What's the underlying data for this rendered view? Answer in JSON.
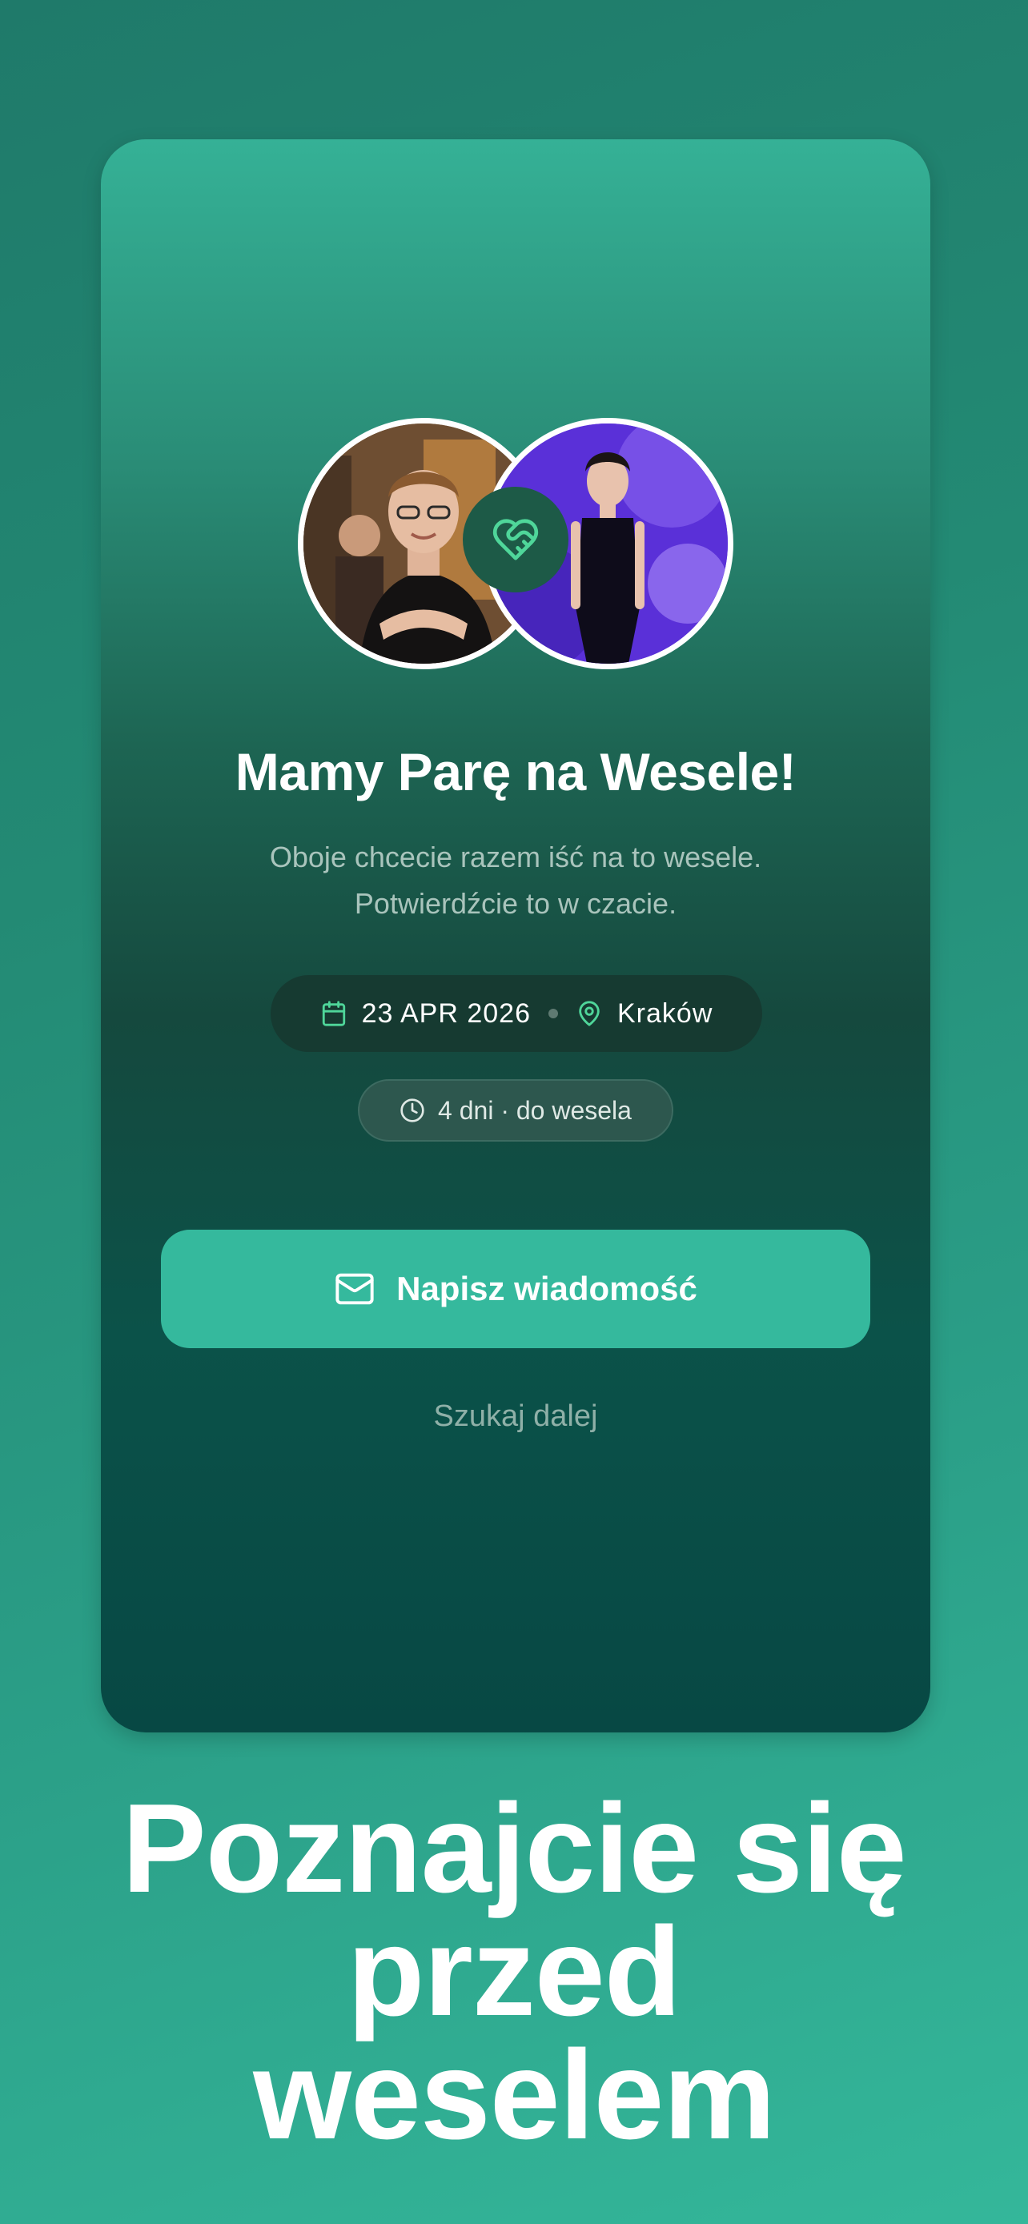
{
  "card": {
    "title": "Mamy Parę na Wesele!",
    "subtitle_lines": [
      "Oboje chcecie razem iść na to wesele.",
      "Potwierdźcie to w czacie."
    ],
    "event": {
      "date": "23 APR 2026",
      "city": "Kraków"
    },
    "countdown": "4 dni · do wesela",
    "cta_label": "Napisz wiadomość",
    "secondary_label": "Szukaj dalej"
  },
  "headline_lines": [
    "Poznajcie się",
    "przed",
    "weselem"
  ],
  "colors": {
    "accent": "#35b99d",
    "icon_accent": "#4fd69a",
    "card_top": "#35b196",
    "card_bottom": "#074844"
  },
  "icons": {
    "match": "heart-handshake-icon",
    "date": "calendar-icon",
    "location": "map-pin-icon",
    "countdown": "clock-icon",
    "cta": "mail-icon"
  }
}
